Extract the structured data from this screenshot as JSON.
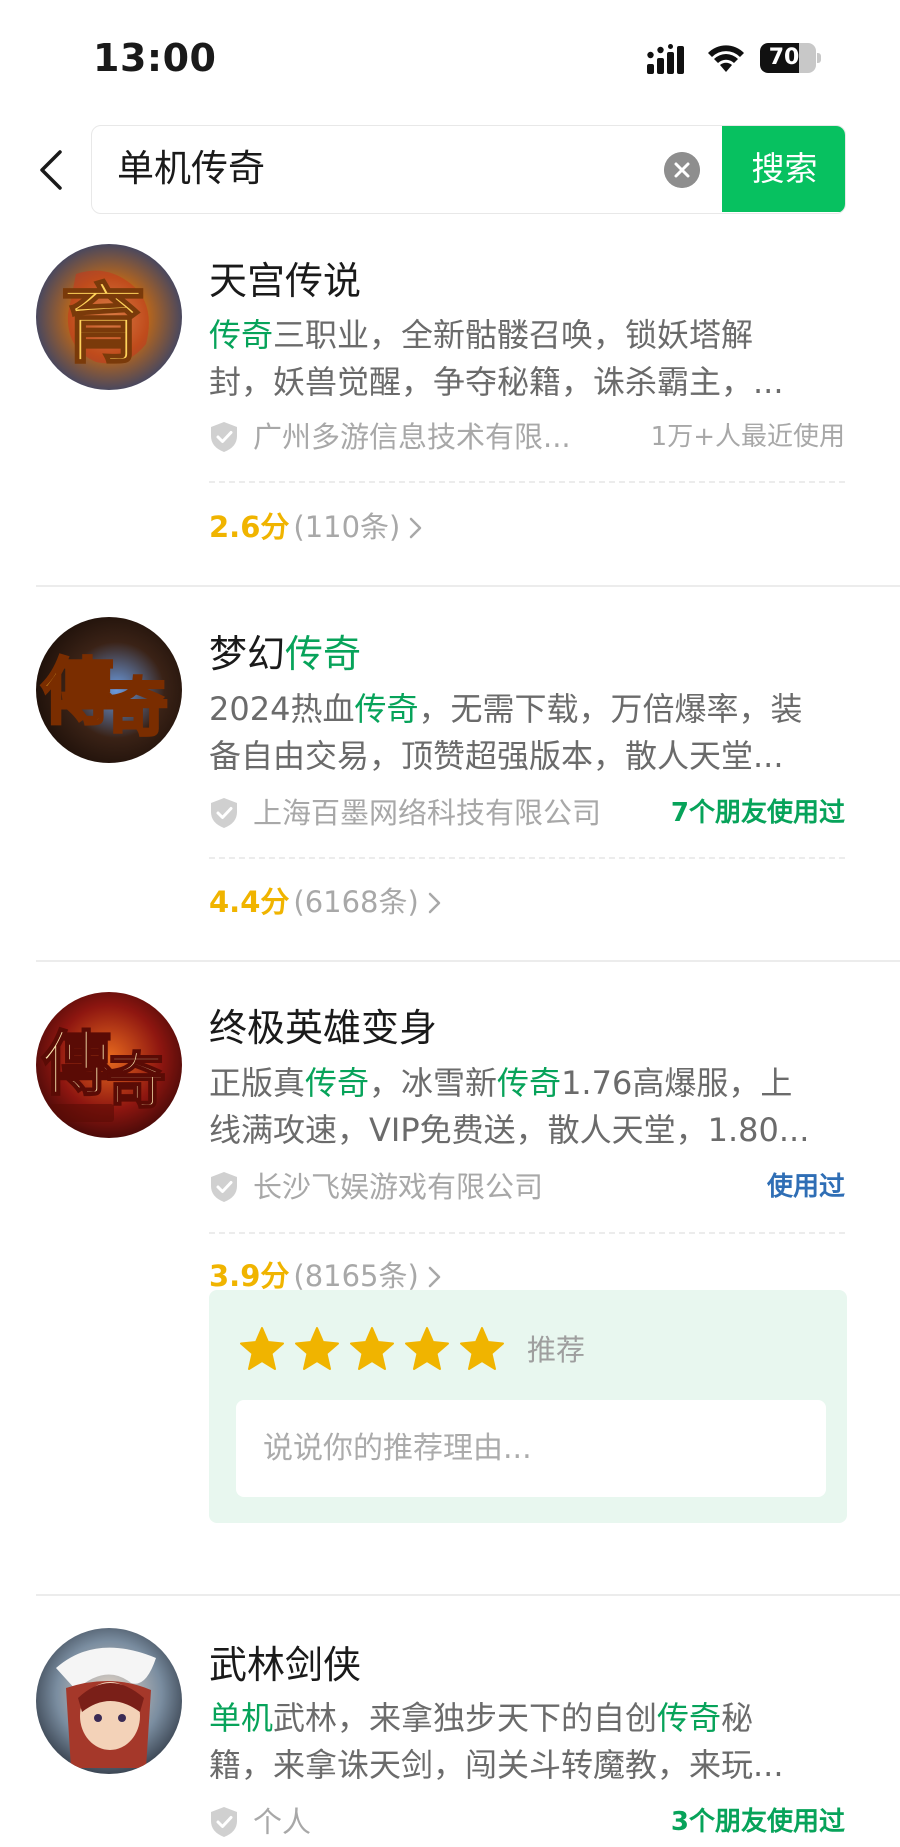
{
  "status_bar": {
    "time": "13:00",
    "battery": "70",
    "battery_level": 0.7
  },
  "search": {
    "query": "单机传奇",
    "button_label": "搜索",
    "icons": [
      "back-arrow-icon",
      "clear-icon"
    ]
  },
  "results": [
    {
      "title": [
        "天宫传说"
      ],
      "title_hl": [],
      "desc_line1": [
        "",
        "传奇",
        "三职业，全新骷髅召唤，锁妖塔解"
      ],
      "desc_line2": "封，妖兽觉醒，争夺秘籍，诛杀霸主，...",
      "company": "广州多游信息技术有限...",
      "usage": "1万+人最近使用",
      "score": "2.6分",
      "count": "(110条)"
    },
    {
      "title_plain": "梦幻",
      "title_hl": "传奇",
      "desc_line1": [
        "2024热血",
        "传奇",
        "，无需下载，万倍爆率，装"
      ],
      "desc_line2": "备自由交易，顶赞超强版本，散人天堂...",
      "company": "上海百墨网络科技有限公司",
      "usage": "7个朋友使用过",
      "score": "4.4分",
      "count": "(6168条)"
    },
    {
      "title": "终极英雄变身",
      "desc_line1": [
        "正版真",
        "传奇",
        "，冰雪新",
        "传奇",
        "1.76高爆服，上"
      ],
      "desc_line2": "线满攻速，VIP免费送，散人天堂，1.80...",
      "company": "长沙飞娱游戏有限公司",
      "usage": "使用过",
      "score": "3.9分",
      "count": "(8165条)"
    },
    {
      "title": "武林剑侠",
      "desc_line1": [
        "单机",
        "武林，来拿独步天下的自创",
        "传奇",
        "秘"
      ],
      "desc_line2": "籍，来拿诛天剑，闯关斗转魔教，来玩...",
      "company": "个人",
      "usage": "3个朋友使用过"
    }
  ],
  "recommend": {
    "stars": 5,
    "label": "推荐",
    "placeholder": "说说你的推荐理由..."
  },
  "colors": {
    "accent_green": "#07c160",
    "highlight_green": "#07a35a",
    "score_yellow": "#f0b400",
    "used_blue": "#2f6eb5",
    "recommend_bg": "#e8f7ef"
  }
}
